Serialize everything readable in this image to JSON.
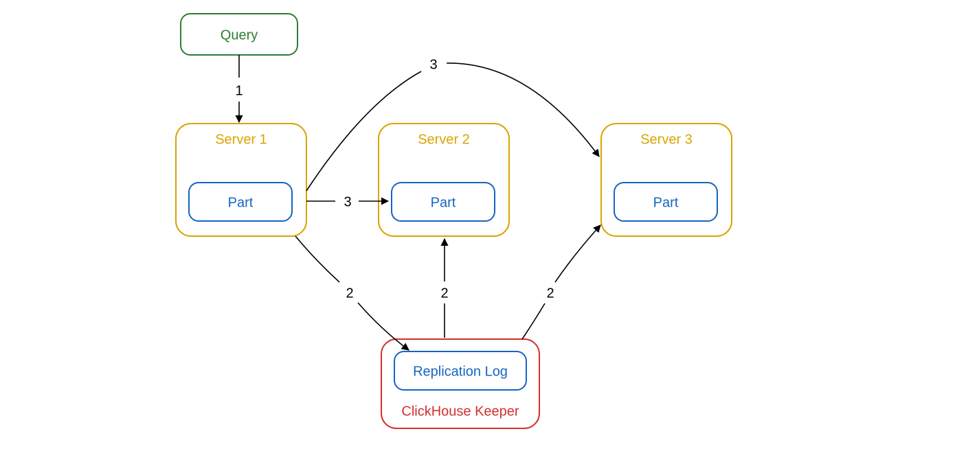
{
  "nodes": {
    "query": {
      "label": "Query",
      "color": "#2e7d32"
    },
    "server1": {
      "label": "Server 1",
      "color": "#d9a400"
    },
    "server2": {
      "label": "Server 2",
      "color": "#d9a400"
    },
    "server3": {
      "label": "Server 3",
      "color": "#d9a400"
    },
    "part1": {
      "label": "Part",
      "color": "#1565c0"
    },
    "part2": {
      "label": "Part",
      "color": "#1565c0"
    },
    "part3": {
      "label": "Part",
      "color": "#1565c0"
    },
    "keeper": {
      "label": "ClickHouse Keeper",
      "color": "#d32f2f"
    },
    "replicationLog": {
      "label": "Replication Log",
      "color": "#1565c0"
    }
  },
  "edges": {
    "e1": {
      "label": "1"
    },
    "e2": {
      "label": "2"
    },
    "e3": {
      "label": "2"
    },
    "e4": {
      "label": "2"
    },
    "e5": {
      "label": "3"
    },
    "e6": {
      "label": "3"
    }
  }
}
